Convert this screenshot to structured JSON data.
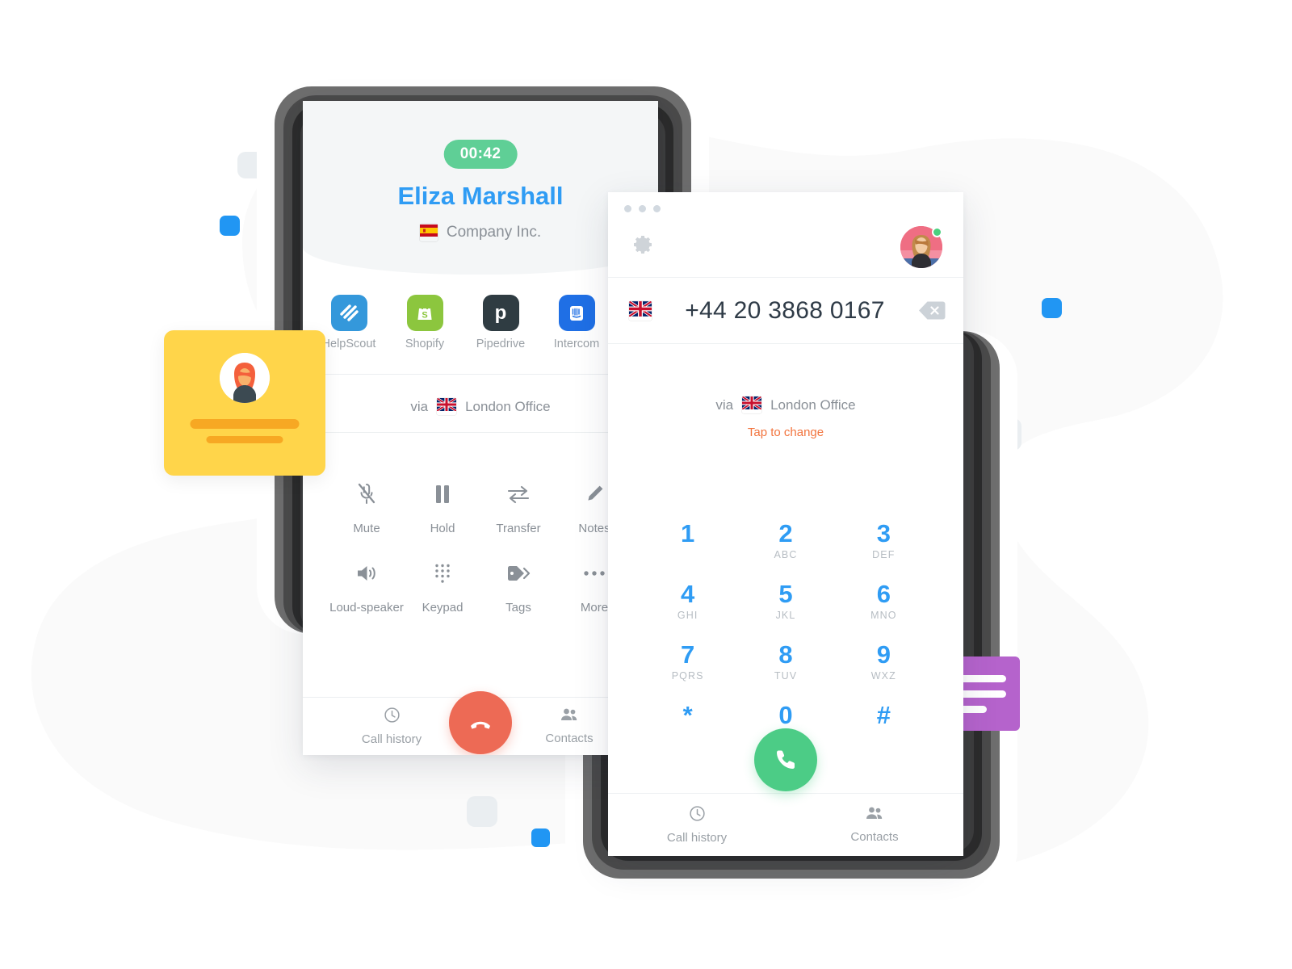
{
  "call_window": {
    "timer": "00:42",
    "caller_name": "Eliza Marshall",
    "caller_company": "Company Inc.",
    "caller_flag": "spain-flag-icon",
    "apps": [
      {
        "label": "HelpScout",
        "icon": "helpscout-icon",
        "color": "#3498db"
      },
      {
        "label": "Shopify",
        "icon": "shopify-icon",
        "color": "#8cc63e"
      },
      {
        "label": "Pipedrive",
        "icon": "pipedrive-icon",
        "color": "#2f3c42"
      },
      {
        "label": "Intercom",
        "icon": "intercom-icon",
        "color": "#1f6fe5"
      }
    ],
    "via_prefix": "via",
    "via_line": "London Office",
    "via_flag": "uk-flag-icon",
    "controls": [
      {
        "label": "Mute",
        "icon": "mic-off-icon"
      },
      {
        "label": "Hold",
        "icon": "pause-icon"
      },
      {
        "label": "Transfer",
        "icon": "transfer-arrows-icon"
      },
      {
        "label": "Notes",
        "icon": "pencil-icon"
      },
      {
        "label": "Loud-speaker",
        "icon": "speaker-icon"
      },
      {
        "label": "Keypad",
        "icon": "keypad-dots-icon"
      },
      {
        "label": "Tags",
        "icon": "tag-icon"
      },
      {
        "label": "More",
        "icon": "ellipsis-icon"
      }
    ],
    "hangup_icon": "phone-hangup-icon",
    "tabs": [
      {
        "label": "Call history",
        "icon": "clock-icon"
      },
      {
        "label": "Contacts",
        "icon": "contacts-icon"
      }
    ]
  },
  "dialer_window": {
    "settings_icon": "gear-icon",
    "avatar_icon": "user-avatar",
    "status": "online",
    "status_color": "#4bd07f",
    "number_flag": "uk-flag-icon",
    "number": "+44 20 3868 0167",
    "backspace_icon": "backspace-icon",
    "via_prefix": "via",
    "via_line": "London Office",
    "via_flag": "uk-flag-icon",
    "tap_to_change": "Tap to change",
    "keys": [
      {
        "digit": "1",
        "letters": ""
      },
      {
        "digit": "2",
        "letters": "ABC"
      },
      {
        "digit": "3",
        "letters": "DEF"
      },
      {
        "digit": "4",
        "letters": "GHI"
      },
      {
        "digit": "5",
        "letters": "JKL"
      },
      {
        "digit": "6",
        "letters": "MNO"
      },
      {
        "digit": "7",
        "letters": "PQRS"
      },
      {
        "digit": "8",
        "letters": "TUV"
      },
      {
        "digit": "9",
        "letters": "WXZ"
      },
      {
        "digit": "*",
        "letters": ""
      },
      {
        "digit": "0",
        "letters": "+"
      },
      {
        "digit": "#",
        "letters": ""
      }
    ],
    "call_icon": "phone-call-icon",
    "tabs": [
      {
        "label": "Call history",
        "icon": "clock-icon"
      },
      {
        "label": "Contacts",
        "icon": "contacts-icon"
      }
    ]
  },
  "decor": {
    "yellow_card": "contact-card-illustration",
    "chat_bubble": "chat-bubble-illustration",
    "accent_blue": "#2196f3",
    "accent_yellow": "#ffd54a",
    "accent_purple": "#b563cc",
    "accent_green": "#5fcf96",
    "accent_red": "#ed6a55",
    "primary_blue": "#2f9cf4"
  }
}
